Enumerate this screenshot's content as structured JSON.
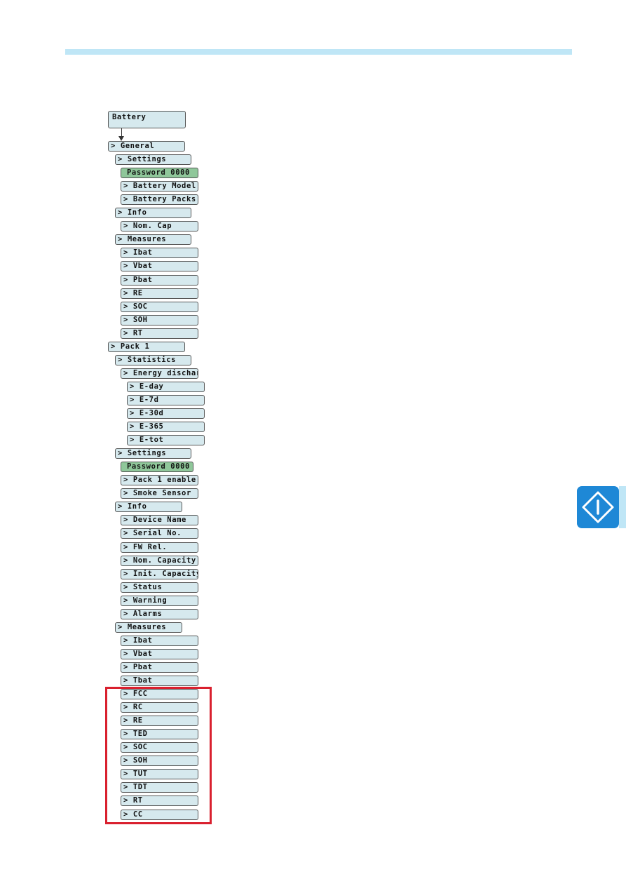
{
  "page": {
    "accent_bar_color": "#bfe6f6",
    "highlight_color": "#d9202e",
    "badge_color": "#1e88d6",
    "badge_icon": "info-diamond-icon"
  },
  "menu": {
    "root": "Battery",
    "items": [
      {
        "label": "> General",
        "level": 0
      },
      {
        "label": "> Settings",
        "level": 1
      },
      {
        "label": "Password 0000",
        "level": 2,
        "type": "password"
      },
      {
        "label": "> Battery Model",
        "level": 2
      },
      {
        "label": "> Battery Packs",
        "level": 2
      },
      {
        "label": "> Info",
        "level": 1
      },
      {
        "label": "> Nom. Cap",
        "level": 2
      },
      {
        "label": "> Measures",
        "level": 1
      },
      {
        "label": "> Ibat",
        "level": 2
      },
      {
        "label": "> Vbat",
        "level": 2
      },
      {
        "label": "> Pbat",
        "level": 2
      },
      {
        "label": "> RE",
        "level": 2
      },
      {
        "label": "> SOC",
        "level": 2
      },
      {
        "label": "> SOH",
        "level": 2
      },
      {
        "label": "> RT",
        "level": 2
      },
      {
        "label": "> Pack 1",
        "level": 0
      },
      {
        "label": "> Statistics",
        "level": 1
      },
      {
        "label": "> Energy dischar.",
        "level": 2
      },
      {
        "label": "> E-day",
        "level": 3
      },
      {
        "label": "> E-7d",
        "level": 3
      },
      {
        "label": "> E-30d",
        "level": 3
      },
      {
        "label": "> E-365",
        "level": 3
      },
      {
        "label": "> E-tot",
        "level": 3
      },
      {
        "label": "> Settings",
        "level": 1
      },
      {
        "label": "Password 0000",
        "level": 2,
        "type": "password"
      },
      {
        "label": "> Pack 1 enable",
        "level": 2
      },
      {
        "label": "> Smoke Sensor",
        "level": 2
      },
      {
        "label": "> Info",
        "level": 1
      },
      {
        "label": "> Device Name",
        "level": 2
      },
      {
        "label": "> Serial No.",
        "level": 2
      },
      {
        "label": "> FW Rel.",
        "level": 2
      },
      {
        "label": "> Nom. Capacity",
        "level": 2
      },
      {
        "label": "> Init. Capacity",
        "level": 2
      },
      {
        "label": "> Status",
        "level": 2
      },
      {
        "label": "> Warning",
        "level": 2
      },
      {
        "label": "> Alarms",
        "level": 2
      },
      {
        "label": "> Measures",
        "level": 1
      },
      {
        "label": "> Ibat",
        "level": 2
      },
      {
        "label": "> Vbat",
        "level": 2
      },
      {
        "label": "> Pbat",
        "level": 2
      },
      {
        "label": "> Tbat",
        "level": 2
      },
      {
        "label": "> FCC",
        "level": 2,
        "highlighted": true
      },
      {
        "label": "> RC",
        "level": 2,
        "highlighted": true
      },
      {
        "label": "> RE",
        "level": 2,
        "highlighted": true
      },
      {
        "label": "> TED",
        "level": 2,
        "highlighted": true
      },
      {
        "label": "> SOC",
        "level": 2,
        "highlighted": true
      },
      {
        "label": "> SOH",
        "level": 2,
        "highlighted": true
      },
      {
        "label": "> TUT",
        "level": 2,
        "highlighted": true
      },
      {
        "label": "> TDT",
        "level": 2,
        "highlighted": true
      },
      {
        "label": "> RT",
        "level": 2,
        "highlighted": true
      },
      {
        "label": "> CC",
        "level": 2,
        "highlighted": true
      }
    ]
  }
}
